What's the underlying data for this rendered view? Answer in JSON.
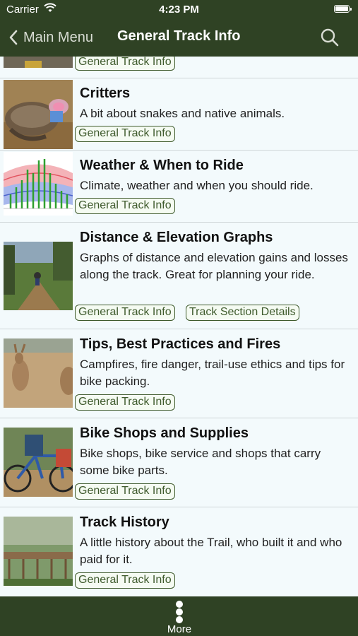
{
  "status": {
    "carrier": "Carrier",
    "time": "4:23 PM"
  },
  "nav": {
    "back_label": "Main Menu",
    "title": "General Track Info"
  },
  "items": [
    {
      "title": "",
      "description": "",
      "tags": [
        "General Track Info"
      ]
    },
    {
      "title": "Critters",
      "description": "A bit about snakes and native animals.",
      "tags": [
        "General Track Info"
      ]
    },
    {
      "title": "Weather & When to Ride",
      "description": "Climate, weather and when you should ride.",
      "tags": [
        "General Track Info"
      ]
    },
    {
      "title": "Distance & Elevation Graphs",
      "description": "Graphs of distance and elevation gains and losses along the track. Great for planning your ride.",
      "tags": [
        "General Track Info",
        "Track Section Details"
      ]
    },
    {
      "title": "Tips, Best Practices and Fires",
      "description": "Campfires, fire danger, trail-use ethics and tips for bike packing.",
      "tags": [
        "General Track Info"
      ]
    },
    {
      "title": "Bike Shops and Supplies",
      "description": "Bike shops, bike service and shops that carry some bike parts.",
      "tags": [
        "General Track Info"
      ]
    },
    {
      "title": "Track History",
      "description": "A little history about the Trail, who built it and who paid for it.",
      "tags": [
        "General Track Info"
      ]
    }
  ],
  "tabbar": {
    "more_label": "More"
  },
  "colors": {
    "bar": "#2f4224",
    "accent": "#3e5a2c",
    "background": "#f3fafc"
  }
}
